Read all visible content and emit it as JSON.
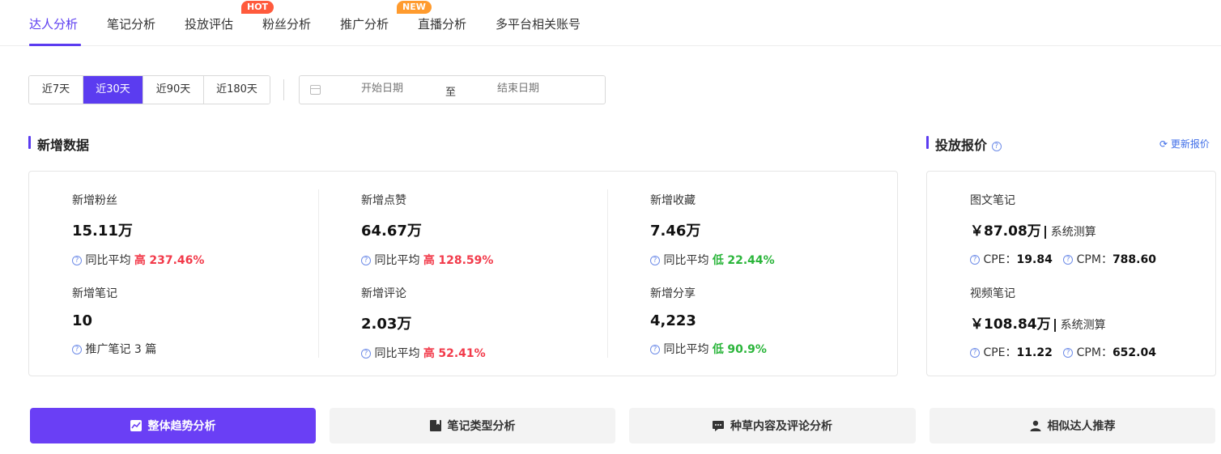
{
  "tabs": [
    {
      "label": "达人分析",
      "active": true
    },
    {
      "label": "笔记分析"
    },
    {
      "label": "投放评估",
      "badge": "HOT"
    },
    {
      "label": "粉丝分析"
    },
    {
      "label": "推广分析",
      "badge": "NEW"
    },
    {
      "label": "直播分析"
    },
    {
      "label": "多平台相关账号"
    }
  ],
  "range": {
    "options": [
      "近7天",
      "近30天",
      "近90天",
      "近180天"
    ],
    "selected": "近30天",
    "start_placeholder": "开始日期",
    "separator": "至",
    "end_placeholder": "结束日期"
  },
  "new_data": {
    "title": "新增数据",
    "stats": [
      {
        "label": "新增粉丝",
        "value": "15.11万",
        "compare_prefix": "同比平均",
        "level": "高",
        "percent": "237.46%"
      },
      {
        "label": "新增点赞",
        "value": "64.67万",
        "compare_prefix": "同比平均",
        "level": "高",
        "percent": "128.59%"
      },
      {
        "label": "新增收藏",
        "value": "7.46万",
        "compare_prefix": "同比平均",
        "level": "低",
        "percent": "22.44%"
      },
      {
        "label": "新增笔记",
        "value": "10",
        "note": "推广笔记 3 篇"
      },
      {
        "label": "新增评论",
        "value": "2.03万",
        "compare_prefix": "同比平均",
        "level": "高",
        "percent": "52.41%"
      },
      {
        "label": "新增分享",
        "value": "4,223",
        "compare_prefix": "同比平均",
        "level": "低",
        "percent": "90.9%"
      }
    ]
  },
  "pricing": {
    "title": "投放报价",
    "refresh_label": "更新报价",
    "items": [
      {
        "label": "图文笔记",
        "price": "￥87.08万",
        "unit": "系统测算",
        "cpe_label": "CPE：",
        "cpe": "19.84",
        "cpm_label": "CPM：",
        "cpm": "788.60"
      },
      {
        "label": "视频笔记",
        "price": "￥108.84万",
        "unit": "系统测算",
        "cpe_label": "CPE：",
        "cpe": "11.22",
        "cpm_label": "CPM：",
        "cpm": "652.04"
      }
    ]
  },
  "bottom_buttons": [
    {
      "label": "整体趋势分析",
      "icon": "trend-chart-icon",
      "active": true
    },
    {
      "label": "笔记类型分析",
      "icon": "bookmark-icon"
    },
    {
      "label": "种草内容及评论分析",
      "icon": "comment-icon"
    },
    {
      "label": "相似达人推荐",
      "icon": "user-icon"
    }
  ],
  "colors": {
    "accent": "#5b3cf0",
    "high": "#f23a4a",
    "low": "#2ab53a",
    "link": "#3f6ee8"
  }
}
